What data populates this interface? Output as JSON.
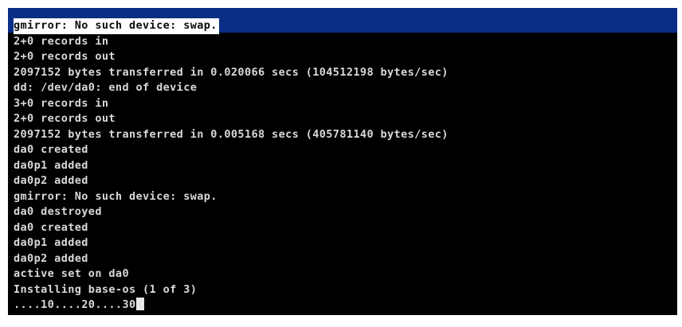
{
  "terminal": {
    "lines": [
      "gmirror: No such device: swap.",
      "2+0 records in",
      "2+0 records out",
      "2097152 bytes transferred in 0.020066 secs (104512198 bytes/sec)",
      "dd: /dev/da0: end of device",
      "3+0 records in",
      "2+0 records out",
      "2097152 bytes transferred in 0.005168 secs (405781140 bytes/sec)",
      "da0 created",
      "da0p1 added",
      "da0p2 added",
      "gmirror: No such device: swap.",
      "da0 destroyed",
      "da0 created",
      "da0p1 added",
      "da0p2 added",
      "active set on da0",
      "Installing base-os (1 of 3)",
      "....10....20....30"
    ]
  },
  "colors": {
    "console_bg": "#000000",
    "text": "#d9d9d9",
    "highlight_bar": "#0a2d86",
    "highlight_text_bg": "#ffffff"
  }
}
